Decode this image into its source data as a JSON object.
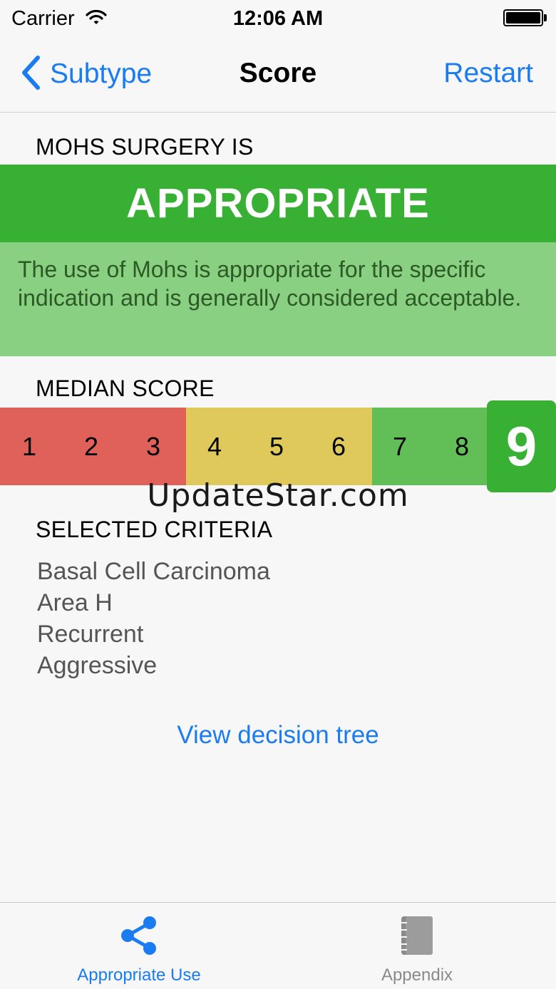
{
  "status": {
    "carrier": "Carrier",
    "time": "12:06 AM"
  },
  "nav": {
    "back_label": "Subtype",
    "title": "Score",
    "restart_label": "Restart"
  },
  "verdict": {
    "heading": "MOHS SURGERY IS",
    "value": "APPROPRIATE",
    "description": "The use of Mohs is appropriate for the specific indication and is generally considered acceptable.",
    "color": "#38b033"
  },
  "median": {
    "heading": "MEDIAN SCORE",
    "scale": [
      "1",
      "2",
      "3",
      "4",
      "5",
      "6",
      "7",
      "8"
    ],
    "score": "9",
    "colors": {
      "low": "#e0605a",
      "mid": "#dfc95a",
      "high": "#62bf57"
    }
  },
  "watermark": "UpdateStar.com",
  "criteria": {
    "heading": "SELECTED CRITERIA",
    "items": [
      "Basal Cell Carcinoma",
      "Area H",
      "Recurrent",
      "Aggressive"
    ]
  },
  "link": {
    "label": "View decision tree"
  },
  "tabs": [
    {
      "label": "Appropriate Use",
      "icon": "share-icon",
      "active": true
    },
    {
      "label": "Appendix",
      "icon": "notebook-icon",
      "active": false
    }
  ],
  "accent": "#1a7cf0"
}
